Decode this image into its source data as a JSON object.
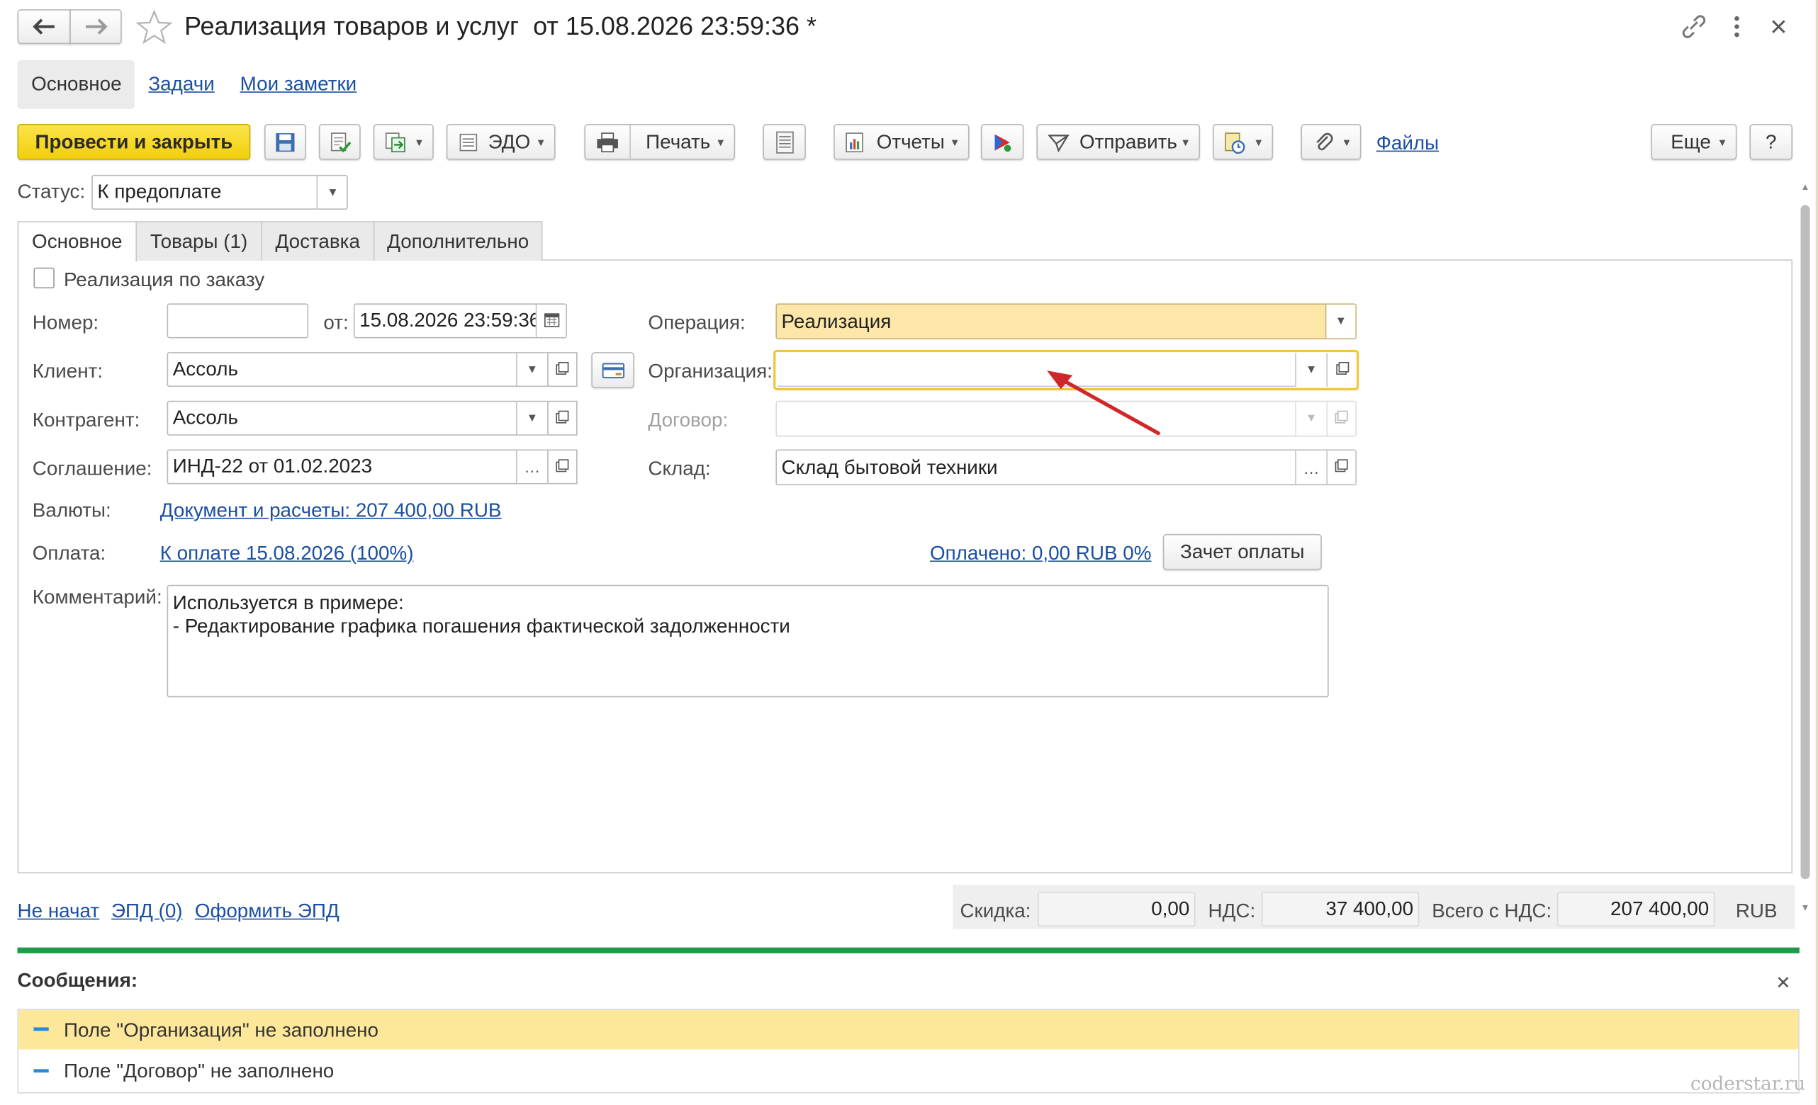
{
  "window": {
    "title": "Реализация товаров и услуг  от 15.08.2026 23:59:36 *"
  },
  "nav_tabs": [
    "Основное",
    "Задачи",
    "Мои заметки"
  ],
  "toolbar": {
    "post_close": "Провести и закрыть",
    "edo": "ЭДО",
    "print": "Печать",
    "reports": "Отчеты",
    "send": "Отправить",
    "files": "Файлы",
    "more": "Еще",
    "help": "?"
  },
  "status": {
    "label": "Статус:",
    "value": "К предоплате"
  },
  "form_tabs": [
    "Основное",
    "Товары (1)",
    "Доставка",
    "Дополнительно"
  ],
  "form": {
    "by_order": "Реализация по заказу",
    "number_label": "Номер:",
    "number_value": "",
    "from_label": "от:",
    "date_value": "15.08.2026 23:59:36",
    "client_label": "Клиент:",
    "client_value": "Ассоль",
    "counterparty_label": "Контрагент:",
    "counterparty_value": "Ассоль",
    "agreement_label": "Соглашение:",
    "agreement_value": "ИНД-22 от 01.02.2023",
    "currency_label": "Валюты:",
    "currency_link": "Документ и расчеты: 207 400,00 RUB",
    "payment_label": "Оплата:",
    "payment_link": "К оплате 15.08.2026 (100%)",
    "paid_link": "Оплачено: 0,00 RUB 0%",
    "offset_button": "Зачет оплаты",
    "comment_label": "Комментарий:",
    "comment_line1": "Используется в примере:",
    "comment_line2": "- Редактирование графика погашения фактической задолженности",
    "operation_label": "Операция:",
    "operation_value": "Реализация",
    "organization_label": "Организация:",
    "organization_value": "",
    "contract_label": "Договор:",
    "contract_value": "",
    "warehouse_label": "Склад:",
    "warehouse_value": "Склад бытовой техники"
  },
  "footer": {
    "not_started": "Не начат",
    "epd": "ЭПД (0)",
    "make_epd": "Оформить ЭПД",
    "discount_label": "Скидка:",
    "discount_value": "0,00",
    "vat_label": "НДС:",
    "vat_value": "37 400,00",
    "total_label": "Всего с НДС:",
    "total_value": "207 400,00",
    "currency": "RUB"
  },
  "messages": {
    "title": "Сообщения:",
    "items": [
      "Поле \"Организация\" не заполнено",
      "Поле \"Договор\" не заполнено"
    ]
  },
  "watermark": "coderstar.ru",
  "colors": {
    "primary_button": "#f5d80f",
    "highlight_field": "#fde7a8",
    "message_highlight": "#fde79b",
    "progress_green": "#1f9a4a",
    "link": "#1a4fa3",
    "arrow": "#d0282a"
  }
}
